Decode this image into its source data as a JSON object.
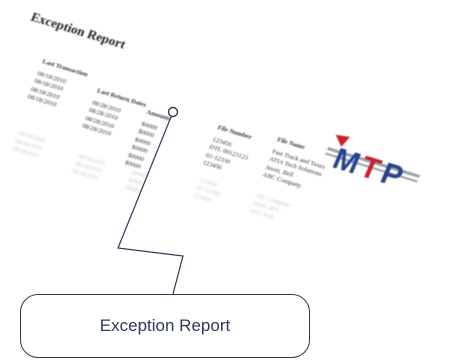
{
  "report": {
    "title": "Exception Report",
    "columns": [
      {
        "header": "Last Transaction",
        "cells": [
          "08/18/2010",
          "08/18/2010",
          "08/18/2010",
          "08/18/2010"
        ]
      },
      {
        "header": "Last Return Dates",
        "cells": [
          "08/28/2010",
          "08/28/2010",
          "08/28/2010",
          "08/28/2010"
        ]
      },
      {
        "header": "Amounts",
        "cells": [
          "$0000",
          "$0000",
          "$0000",
          "$0000",
          "$0000",
          "$0000"
        ]
      },
      {
        "header": "File Number",
        "cells": [
          "123456",
          "DTL 00123123",
          "01-12330",
          "123456"
        ]
      },
      {
        "header": "File Name",
        "cells": [
          "Fast Track and Taxes",
          "ATIA Tech Solutions",
          "Jason, Bell",
          "ABC Company"
        ]
      }
    ],
    "ghost_columns": [
      [
        "08/18/2010",
        "08/18/2010",
        "08/18/2010"
      ],
      [
        "08/28/2010",
        "08/28/2010",
        "08/28/2010"
      ],
      [
        "$0000",
        "$0000",
        "$0000"
      ],
      [
        "123456",
        "01-12330",
        "123456"
      ],
      [
        "ABC Company",
        "Jason, Bell",
        "ATIA Tech"
      ]
    ]
  },
  "logo": {
    "text": "MTP",
    "colors": {
      "blue": "#27408f",
      "red": "#c8202b",
      "gray": "#9aa0a8"
    }
  },
  "callout": {
    "label": "Exception Report",
    "color": "#2b3a55"
  }
}
